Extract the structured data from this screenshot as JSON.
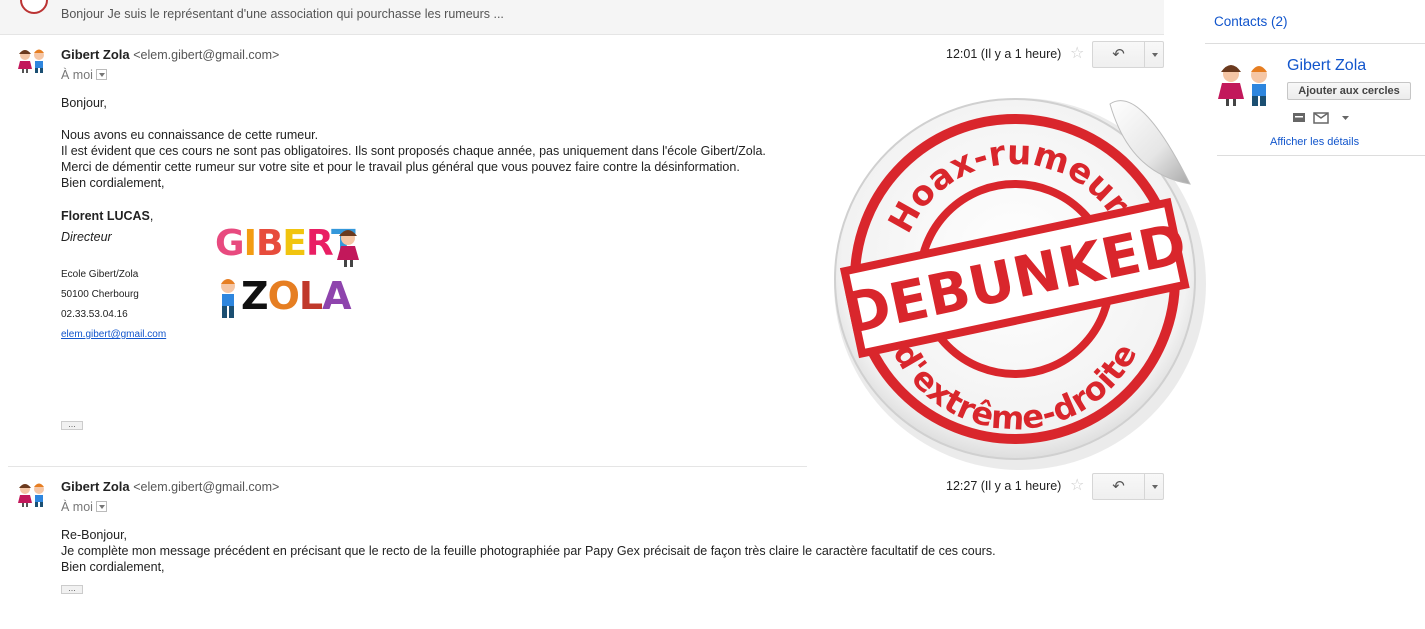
{
  "collapsed": {
    "snippet": "Bonjour Je suis le représentant d'une association qui pourchasse les rumeurs ..."
  },
  "msg1": {
    "sender": "Gibert Zola",
    "email": "<elem.gibert@gmail.com>",
    "to": "À moi",
    "time": "12:01 (Il y a 1 heure)",
    "lines": [
      "Bonjour,",
      "Nous avons eu connaissance de cette rumeur.",
      "Il est évident que ces cours ne sont pas obligatoires. Ils sont proposés chaque année, pas uniquement dans l'école Gibert/Zola.",
      "Merci de démentir cette rumeur sur votre site et pour le travail plus général que vous pouvez faire contre la désinformation.",
      "Bien cordialement,"
    ],
    "signature": {
      "name": "Florent LUCAS",
      "name_suffix": ",",
      "title": "Directeur",
      "school": "Ecole Gibert/Zola",
      "city": "50100 Cherbourg",
      "phone": "02.33.53.04.16",
      "email": "elem.gibert@gmail.com"
    },
    "logo": {
      "line1": "GIBERT",
      "line2": "ZOLA"
    },
    "dots": "..."
  },
  "msg2": {
    "sender": "Gibert Zola",
    "email": "<elem.gibert@gmail.com>",
    "to": "À moi",
    "time": "12:27 (Il y a 1 heure)",
    "lines": [
      "Re-Bonjour,",
      "Je complète mon message précédent en précisant que le recto de la feuille photographiée par Papy Gex précisait de façon très claire le caractère facultatif de ces cours.",
      "Bien cordialement,"
    ],
    "dots": "..."
  },
  "sticker": {
    "top_text": "Hoax-rumeurs",
    "banner": "DEBUNKED",
    "bottom_text": "d'extrême-droite"
  },
  "sidebar": {
    "contacts_link": "Contacts (2)",
    "contact_name": "Gibert Zola",
    "add_button": "Ajouter aux cercles",
    "details_link": "Afficher les détails"
  },
  "colors": {
    "link": "#1155cc",
    "stamp_red": "#d9262c"
  }
}
